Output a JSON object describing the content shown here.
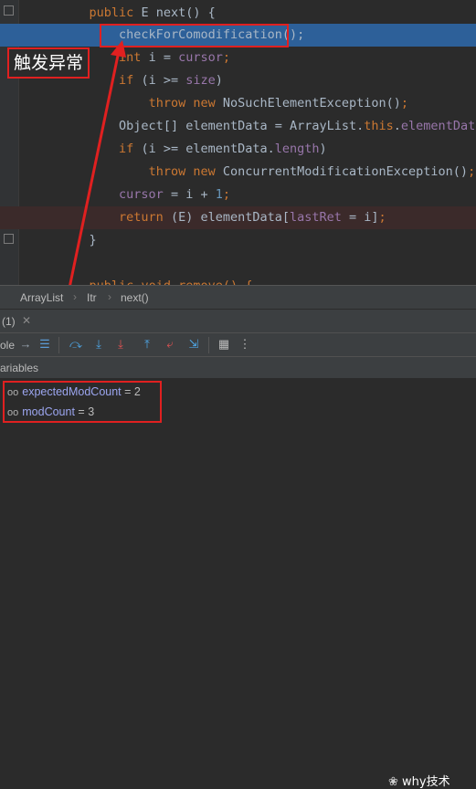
{
  "code": {
    "lines": [
      {
        "indent": "    ",
        "parts": [
          {
            "t": "public ",
            "c": "kw"
          },
          {
            "t": "E ",
            "c": "ctx"
          },
          {
            "t": "next() {",
            "c": "ctx"
          }
        ]
      },
      {
        "indent": "        ",
        "parts": [
          {
            "t": "checkForComodification();",
            "c": "ctx"
          }
        ]
      },
      {
        "indent": "        ",
        "parts": [
          {
            "t": "int ",
            "c": "kw"
          },
          {
            "t": "i = ",
            "c": "ctx"
          },
          {
            "t": "cursor",
            "c": "fld"
          },
          {
            "t": ";",
            "c": "kw"
          }
        ]
      },
      {
        "indent": "        ",
        "parts": [
          {
            "t": "if ",
            "c": "kw"
          },
          {
            "t": "(i >= ",
            "c": "ctx"
          },
          {
            "t": "size",
            "c": "fld"
          },
          {
            "t": ")",
            "c": "ctx"
          }
        ]
      },
      {
        "indent": "            ",
        "parts": [
          {
            "t": "throw new ",
            "c": "kw"
          },
          {
            "t": "NoSuchElementException()",
            "c": "ctx"
          },
          {
            "t": ";",
            "c": "kw"
          }
        ]
      },
      {
        "indent": "        ",
        "parts": [
          {
            "t": "Object[] elementData = ArrayList.",
            "c": "ctx"
          },
          {
            "t": "this",
            "c": "kw"
          },
          {
            "t": ".",
            "c": "ctx"
          },
          {
            "t": "elementData",
            "c": "fld"
          },
          {
            "t": ";",
            "c": "kw"
          }
        ]
      },
      {
        "indent": "        ",
        "parts": [
          {
            "t": "if ",
            "c": "kw"
          },
          {
            "t": "(i >= elementData.",
            "c": "ctx"
          },
          {
            "t": "length",
            "c": "fld"
          },
          {
            "t": ")",
            "c": "ctx"
          }
        ]
      },
      {
        "indent": "            ",
        "parts": [
          {
            "t": "throw new ",
            "c": "kw"
          },
          {
            "t": "ConcurrentModificationException()",
            "c": "ctx"
          },
          {
            "t": ";",
            "c": "kw"
          }
        ]
      },
      {
        "indent": "        ",
        "parts": [
          {
            "t": "cursor",
            "c": "fld"
          },
          {
            "t": " = i + ",
            "c": "ctx"
          },
          {
            "t": "1",
            "c": "num"
          },
          {
            "t": ";",
            "c": "kw"
          }
        ]
      },
      {
        "indent": "        ",
        "parts": [
          {
            "t": "return ",
            "c": "kw"
          },
          {
            "t": "(E) elementData[",
            "c": "ctx"
          },
          {
            "t": "lastRet",
            "c": "fld"
          },
          {
            "t": " = i]",
            "c": "ctx"
          },
          {
            "t": ";",
            "c": "kw"
          }
        ]
      },
      {
        "indent": "    ",
        "parts": [
          {
            "t": "}",
            "c": "ctx"
          }
        ]
      },
      {
        "indent": "",
        "parts": []
      },
      {
        "indent": "    ",
        "parts": [
          {
            "t": "public void remove() {",
            "c": "kw"
          }
        ]
      }
    ]
  },
  "annotation": {
    "label": "触发异常"
  },
  "breadcrumb": [
    "ArrayList",
    "Itr",
    "next()"
  ],
  "debug": {
    "frame_count": "(1)",
    "panel_label": "ole",
    "variables_label": "ariables"
  },
  "variables": [
    {
      "name": "expectedModCount",
      "value": "2"
    },
    {
      "name": "modCount",
      "value": "3"
    }
  ],
  "watermark": "why技术",
  "colors": {
    "highlight": "#2d6099",
    "annotation": "#e02020"
  }
}
